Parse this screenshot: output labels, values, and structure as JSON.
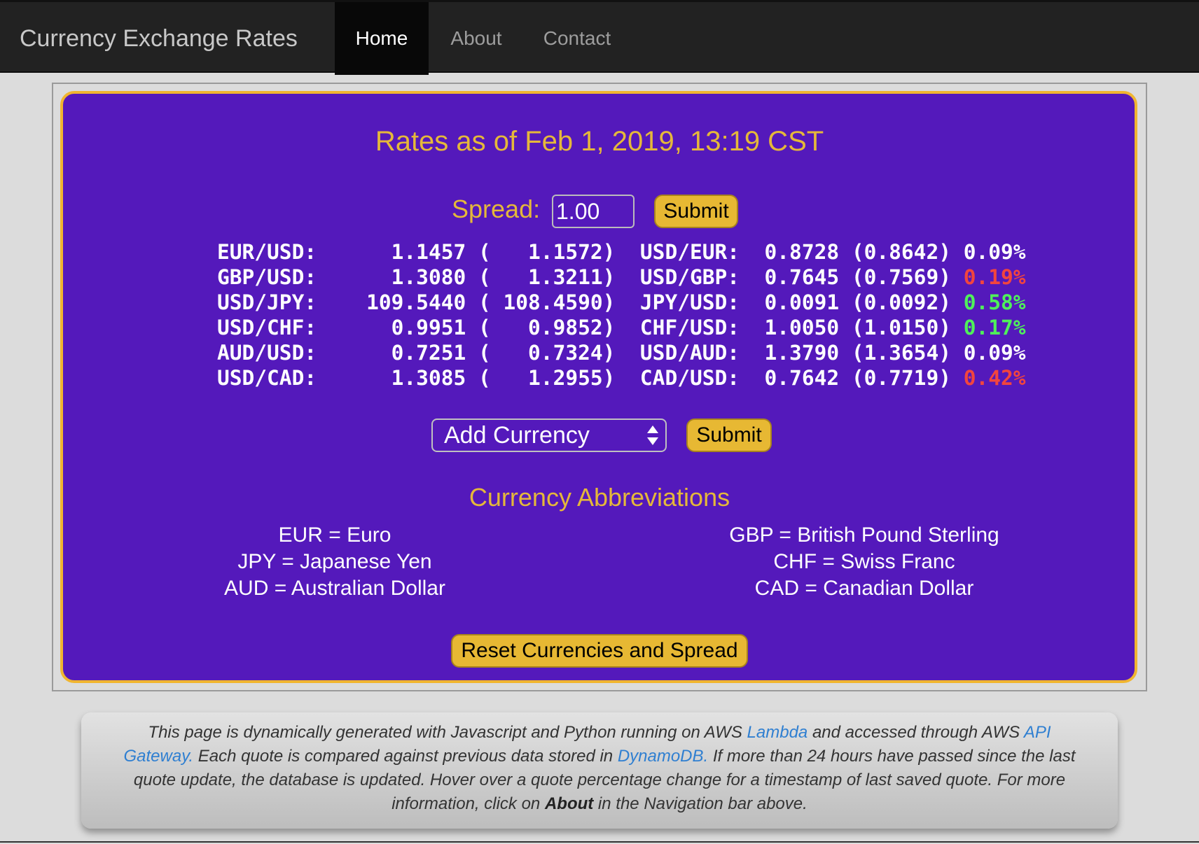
{
  "nav": {
    "brand": "Currency Exchange Rates",
    "home": "Home",
    "about": "About",
    "contact": "Contact"
  },
  "main": {
    "title": "Rates as of Feb 1, 2019, 13:19 CST",
    "spread_label": "Spread:",
    "spread_value": "1.00",
    "spread_submit": "Submit",
    "rates": [
      {
        "pair": "EUR/USD:",
        "rate": "1.1457",
        "prev": "1.1572",
        "inv_pair": "USD/EUR:",
        "inv_rate": "0.8728",
        "inv_prev": "0.8642",
        "change": "0.09%",
        "trend": "flat"
      },
      {
        "pair": "GBP/USD:",
        "rate": "1.3080",
        "prev": "1.3211",
        "inv_pair": "USD/GBP:",
        "inv_rate": "0.7645",
        "inv_prev": "0.7569",
        "change": "0.19%",
        "trend": "down"
      },
      {
        "pair": "USD/JPY:",
        "rate": "109.5440",
        "prev": "108.4590",
        "inv_pair": "JPY/USD:",
        "inv_rate": "0.0091",
        "inv_prev": "0.0092",
        "change": "0.58%",
        "trend": "up"
      },
      {
        "pair": "USD/CHF:",
        "rate": "0.9951",
        "prev": "0.9852",
        "inv_pair": "CHF/USD:",
        "inv_rate": "1.0050",
        "inv_prev": "1.0150",
        "change": "0.17%",
        "trend": "up"
      },
      {
        "pair": "AUD/USD:",
        "rate": "0.7251",
        "prev": "0.7324",
        "inv_pair": "USD/AUD:",
        "inv_rate": "1.3790",
        "inv_prev": "1.3654",
        "change": "0.09%",
        "trend": "flat"
      },
      {
        "pair": "USD/CAD:",
        "rate": "1.3085",
        "prev": "1.2955",
        "inv_pair": "CAD/USD:",
        "inv_rate": "0.7642",
        "inv_prev": "0.7719",
        "change": "0.42%",
        "trend": "down"
      }
    ],
    "add_currency_selected": "Add Currency",
    "add_submit": "Submit",
    "abbr_heading": "Currency Abbreviations",
    "abbr_left": [
      "EUR = Euro",
      "JPY = Japanese Yen",
      "AUD = Australian Dollar"
    ],
    "abbr_right": [
      "GBP = British Pound Sterling",
      "CHF = Swiss Franc",
      "CAD = Canadian Dollar"
    ],
    "reset_label": "Reset Currencies and Spread"
  },
  "note": {
    "part1": "This page is dynamically generated with Javascript and Python running on AWS ",
    "link_lambda": "Lambda",
    "part2": " and accessed through AWS ",
    "link_api": "API Gateway.",
    "part3": " Each quote is compared against previous data stored in ",
    "link_dynamo": "DynamoDB.",
    "part4": " If more than 24 hours have passed since the last quote update, the database is updated. Hover over a quote percentage change for a timestamp of last saved quote. For more information, click on ",
    "about_bold": "About",
    "part5": " in the Navigation bar above."
  },
  "colors": {
    "panel_bg": "#5419bb",
    "accent_gold": "#e5b83a",
    "up_green": "#4ff05a",
    "down_red": "#f2453e",
    "link_blue": "#2f7fd1"
  }
}
